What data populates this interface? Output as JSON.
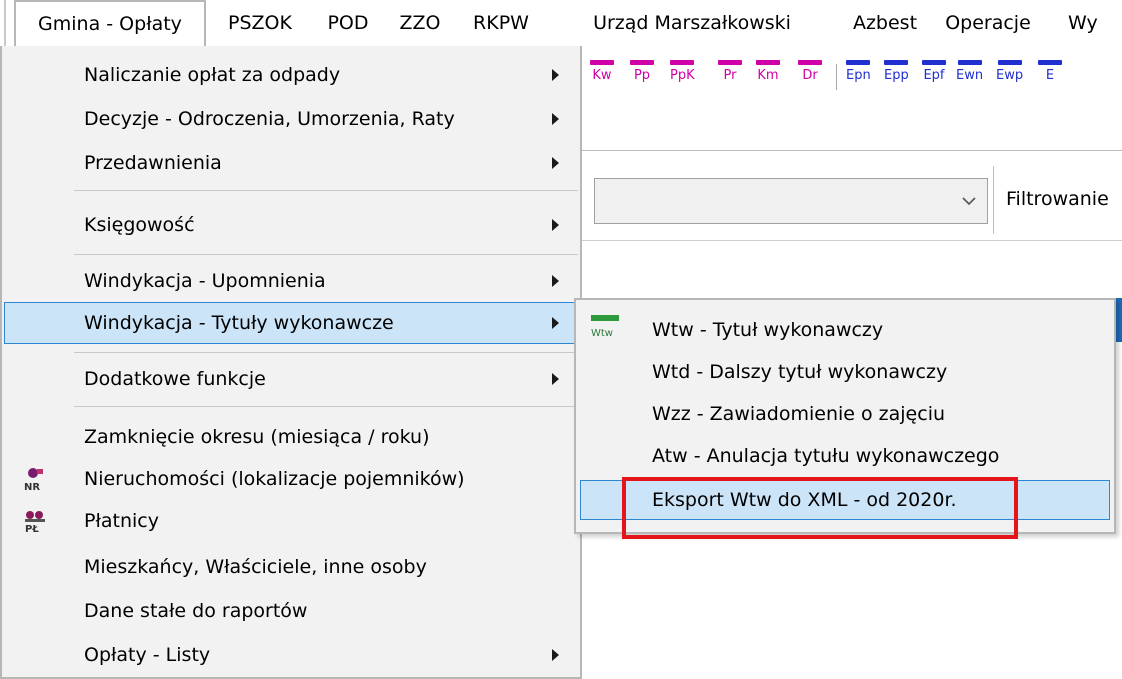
{
  "menubar": {
    "items": [
      "Gmina - Opłaty",
      "PSZOK",
      "POD",
      "ZZO",
      "RKPW",
      "Urząd Marszałkowski",
      "Azbest",
      "Operacje",
      "Wy"
    ]
  },
  "toolbar": {
    "buttons": [
      {
        "label": "Kw",
        "color": "#d000a8"
      },
      {
        "label": "Pp",
        "color": "#d000a8"
      },
      {
        "label": "PpK",
        "color": "#d000a8"
      },
      {
        "label": "Pr",
        "color": "#d000a8"
      },
      {
        "label": "Km",
        "color": "#d000a8"
      },
      {
        "label": "Dr",
        "color": "#d000a8"
      },
      {
        "label": "Epn",
        "color": "#2030d0"
      },
      {
        "label": "Epp",
        "color": "#2030d0"
      },
      {
        "label": "Epf",
        "color": "#2030d0"
      },
      {
        "label": "Ewn",
        "color": "#2030d0"
      },
      {
        "label": "Ewp",
        "color": "#2030d0"
      },
      {
        "label": "E",
        "color": "#2030d0"
      }
    ]
  },
  "background": {
    "filter_label": "Filtrowanie"
  },
  "menu": {
    "items": [
      {
        "label": "Naliczanie opłat za odpady",
        "submenu": true
      },
      {
        "label": "Decyzje  - Odroczenia, Umorzenia, Raty",
        "submenu": true
      },
      {
        "label": "Przedawnienia",
        "submenu": true
      },
      {
        "label": "Księgowość",
        "submenu": true
      },
      {
        "label": "Windykacja - Upomnienia",
        "submenu": true
      },
      {
        "label": "Windykacja - Tytuły wykonawcze",
        "submenu": true,
        "selected": true
      },
      {
        "label": "Dodatkowe funkcje",
        "submenu": true
      },
      {
        "label": "Zamknięcie okresu (miesiąca / roku)",
        "submenu": false
      },
      {
        "label": "Nieruchomości (lokalizacje pojemników)",
        "submenu": false,
        "icon": "NR"
      },
      {
        "label": "Płatnicy",
        "submenu": false,
        "icon": "PŁ"
      },
      {
        "label": "Mieszkańcy, Właściciele, inne osoby",
        "submenu": false
      },
      {
        "label": "Dane stałe do raportów",
        "submenu": false
      },
      {
        "label": "Opłaty - Listy",
        "submenu": true
      }
    ]
  },
  "submenu": {
    "icon_label": "Wtw",
    "items": [
      {
        "label": "Wtw - Tytuł wykonawczy"
      },
      {
        "label": "Wtd - Dalszy tytuł wykonawczy"
      },
      {
        "label": "Wzz - Zawiadomienie o zajęciu"
      },
      {
        "label": "Atw - Anulacja tytułu wykonawczego"
      },
      {
        "label": "Eksport Wtw do XML - od 2020r.",
        "selected": true
      }
    ]
  },
  "colors": {
    "selection_bg": "#cce4f7",
    "selection_border": "#2f86d2",
    "annotation_red": "#e4141b"
  }
}
